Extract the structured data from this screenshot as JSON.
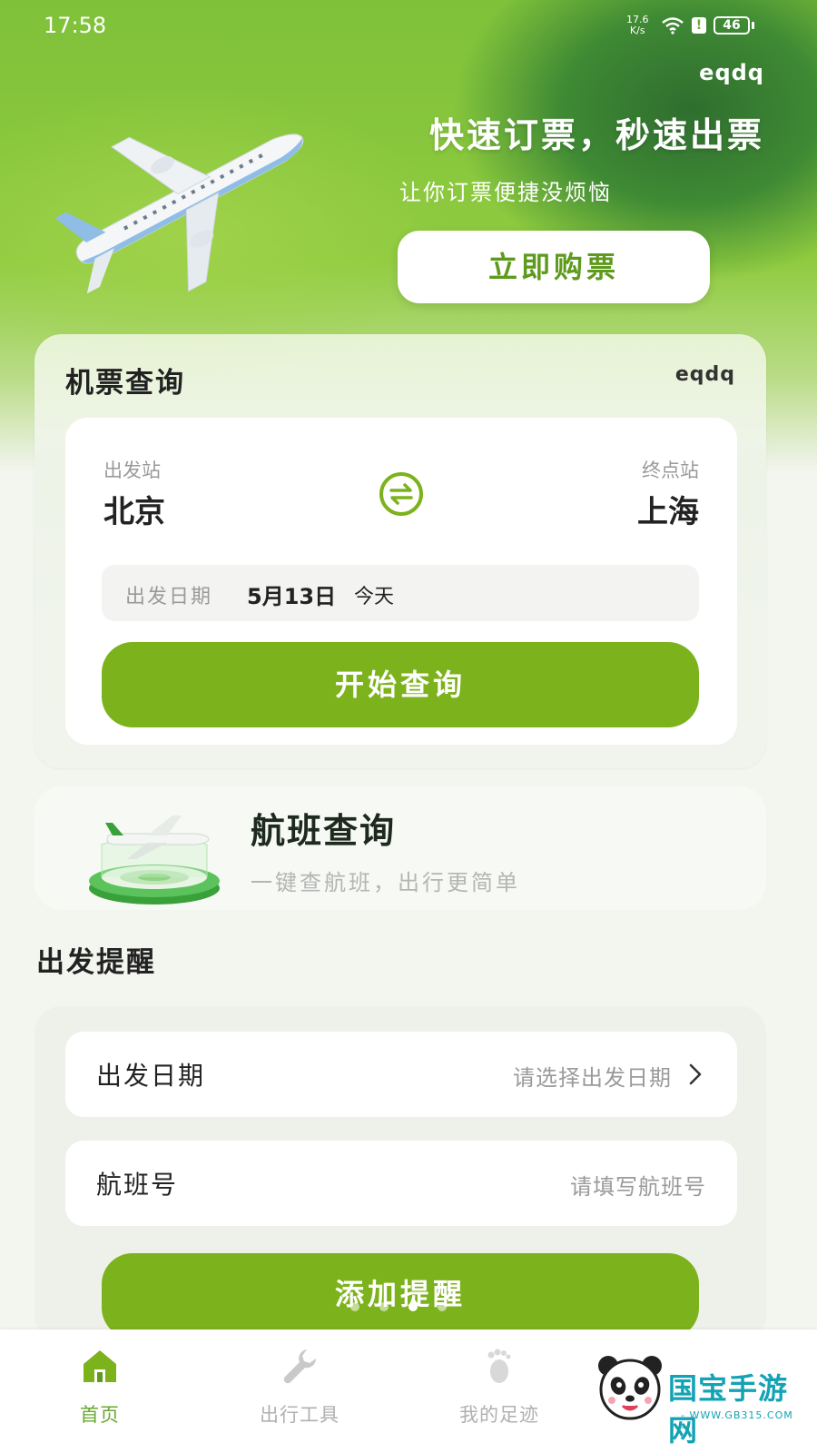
{
  "status": {
    "time": "17:58",
    "speed_value": "17.6",
    "speed_unit": "K/s",
    "alert": "!",
    "battery": "46"
  },
  "hero": {
    "brand": "eqdq",
    "title": "快速订票，秒速出票",
    "subtitle": "让你订票便捷没烦恼",
    "buy_button": "立即购票"
  },
  "ticket_search": {
    "title": "机票查询",
    "brand": "eqdq",
    "from_label": "出发站",
    "from_city": "北京",
    "to_label": "终点站",
    "to_city": "上海",
    "date_label": "出发日期",
    "date_value": "5月13日",
    "date_today": "今天",
    "search_button": "开始查询"
  },
  "flight_query": {
    "title": "航班查询",
    "subtitle": "一键查航班，出行更简单"
  },
  "reminder": {
    "title": "出发提醒",
    "date_label": "出发日期",
    "date_placeholder": "请选择出发日期",
    "flight_label": "航班号",
    "flight_placeholder": "请填写航班号",
    "add_button": "添加提醒",
    "carousel_dots": 4,
    "carousel_active_index": 2
  },
  "tabbar": {
    "items": [
      {
        "label": "首页",
        "icon": "home-icon",
        "active": true
      },
      {
        "label": "出行工具",
        "icon": "wrench-icon",
        "active": false
      },
      {
        "label": "我的足迹",
        "icon": "footprint-icon",
        "active": false
      }
    ]
  },
  "watermark": {
    "text": "国宝手游网",
    "url": "- WWW.GB315.COM -"
  },
  "colors": {
    "accent": "#7cb21b",
    "accent_text": "#6aa82e",
    "hero_green": "#7fc13a"
  }
}
